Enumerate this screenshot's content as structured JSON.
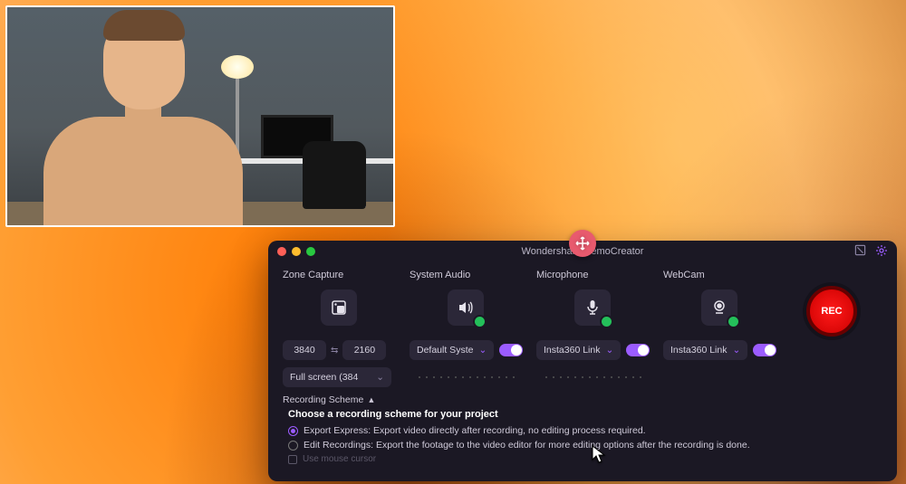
{
  "window": {
    "title": "Wondershare DemoCreator"
  },
  "columns": {
    "zone": {
      "label": "Zone Capture"
    },
    "system": {
      "label": "System Audio"
    },
    "mic": {
      "label": "Microphone"
    },
    "cam": {
      "label": "WebCam"
    }
  },
  "rec_label": "REC",
  "dimensions": {
    "width": "3840",
    "height": "2160"
  },
  "system_select": "Default Syste",
  "mic_select": "Insta360 Link",
  "cam_select": "Insta360 Link",
  "fullscreen_select": "Full screen (384",
  "scheme": {
    "header": "Recording Scheme",
    "title": "Choose a recording scheme for your project",
    "option1": "Export Express: Export video directly after recording, no editing process required.",
    "option2": "Edit Recordings: Export the footage to the video editor for more editing options after the recording is done.",
    "cursor": "Use mouse cursor"
  }
}
